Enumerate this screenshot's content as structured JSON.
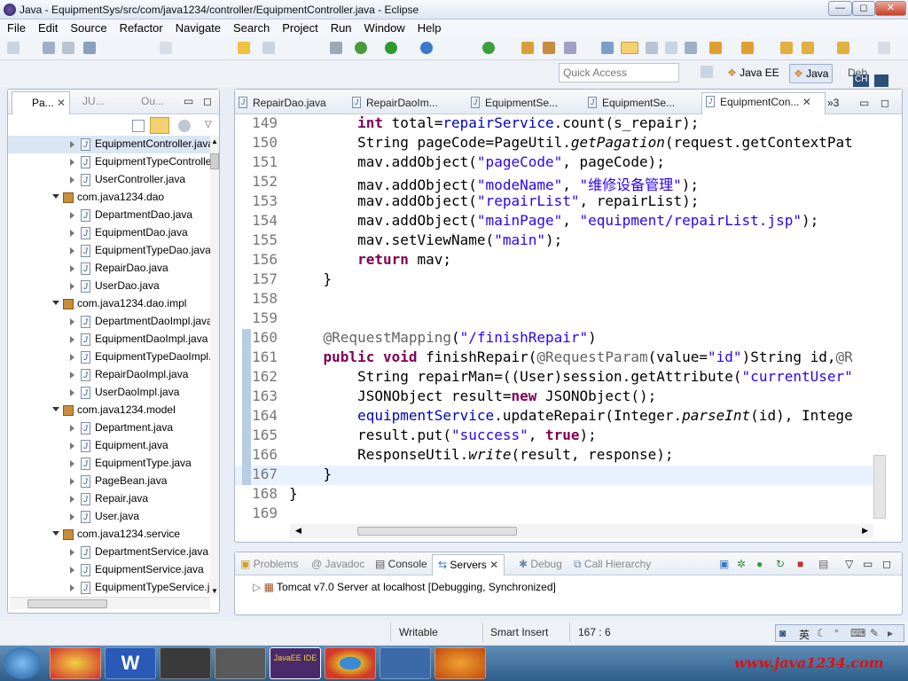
{
  "window": {
    "title": "Java - EquipmentSys/src/com/java1234/controller/EquipmentController.java - Eclipse"
  },
  "menu": [
    "File",
    "Edit",
    "Source",
    "Refactor",
    "Navigate",
    "Search",
    "Project",
    "Run",
    "Window",
    "Help"
  ],
  "quick_access": "Quick Access",
  "perspectives": {
    "javaee": "Java EE",
    "java": "Java",
    "debug": "Deb"
  },
  "left": {
    "tabs": [
      "Pa...",
      "JU...",
      "Ou..."
    ],
    "tree": [
      {
        "type": "file",
        "label": "EquipmentController.java",
        "indent": 1
      },
      {
        "type": "file",
        "label": "EquipmentTypeController.java",
        "indent": 1
      },
      {
        "type": "file",
        "label": "UserController.java",
        "indent": 1
      },
      {
        "type": "pkg",
        "label": "com.java1234.dao",
        "indent": 0
      },
      {
        "type": "file",
        "label": "DepartmentDao.java",
        "indent": 1
      },
      {
        "type": "file",
        "label": "EquipmentDao.java",
        "indent": 1
      },
      {
        "type": "file",
        "label": "EquipmentTypeDao.java",
        "indent": 1
      },
      {
        "type": "file",
        "label": "RepairDao.java",
        "indent": 1
      },
      {
        "type": "file",
        "label": "UserDao.java",
        "indent": 1
      },
      {
        "type": "pkg",
        "label": "com.java1234.dao.impl",
        "indent": 0
      },
      {
        "type": "file",
        "label": "DepartmentDaoImpl.java",
        "indent": 1
      },
      {
        "type": "file",
        "label": "EquipmentDaoImpl.java",
        "indent": 1
      },
      {
        "type": "file",
        "label": "EquipmentTypeDaoImpl.java",
        "indent": 1
      },
      {
        "type": "file",
        "label": "RepairDaoImpl.java",
        "indent": 1
      },
      {
        "type": "file",
        "label": "UserDaoImpl.java",
        "indent": 1
      },
      {
        "type": "pkg",
        "label": "com.java1234.model",
        "indent": 0
      },
      {
        "type": "file",
        "label": "Department.java",
        "indent": 1
      },
      {
        "type": "file",
        "label": "Equipment.java",
        "indent": 1
      },
      {
        "type": "file",
        "label": "EquipmentType.java",
        "indent": 1
      },
      {
        "type": "file",
        "label": "PageBean.java",
        "indent": 1
      },
      {
        "type": "file",
        "label": "Repair.java",
        "indent": 1
      },
      {
        "type": "file",
        "label": "User.java",
        "indent": 1
      },
      {
        "type": "pkg",
        "label": "com.java1234.service",
        "indent": 0
      },
      {
        "type": "file",
        "label": "DepartmentService.java",
        "indent": 1
      },
      {
        "type": "file",
        "label": "EquipmentService.java",
        "indent": 1
      },
      {
        "type": "file",
        "label": "EquipmentTypeService.java",
        "indent": 1
      }
    ]
  },
  "editor": {
    "tabs": [
      "RepairDao.java",
      "RepairDaoIm...",
      "EquipmentSe...",
      "EquipmentSe...",
      "EquipmentCon..."
    ],
    "overflow": "»3",
    "lines": [
      {
        "n": "149",
        "html": "        <span class='kw'>int</span> total=<span class='fd'>repairService</span>.count(s_repair);"
      },
      {
        "n": "150",
        "html": "        String pageCode=PageUtil.<span class='it'>getPagation</span>(request.getContextPat"
      },
      {
        "n": "151",
        "html": "        mav.addObject(<span class='st'>\"pageCode\"</span>, pageCode);"
      },
      {
        "n": "152",
        "html": "        mav.addObject(<span class='st'>\"modeName\"</span>, <span class='st'>\"维修设备管理\"</span>);"
      },
      {
        "n": "153",
        "html": "        mav.addObject(<span class='st'>\"repairList\"</span>, repairList);"
      },
      {
        "n": "154",
        "html": "        mav.addObject(<span class='st'>\"mainPage\"</span>, <span class='st'>\"equipment/repairList.jsp\"</span>);"
      },
      {
        "n": "155",
        "html": "        mav.setViewName(<span class='st'>\"main\"</span>);"
      },
      {
        "n": "156",
        "html": "        <span class='kw'>return</span> mav;"
      },
      {
        "n": "157",
        "html": "    }"
      },
      {
        "n": "158",
        "html": ""
      },
      {
        "n": "159",
        "html": ""
      },
      {
        "n": "160",
        "html": "    <span class='an'>@RequestMapping</span>(<span class='st'>\"/finishRepair\"</span>)"
      },
      {
        "n": "161",
        "html": "    <span class='kw'>public</span> <span class='kw'>void</span> finishRepair(<span class='an'>@RequestParam</span>(value=<span class='st'>\"id\"</span>)String id,<span class='an'>@R</span>"
      },
      {
        "n": "162",
        "html": "        String repairMan=((User)session.getAttribute(<span class='st'>\"currentUser\"</span>"
      },
      {
        "n": "163",
        "html": "        JSONObject result=<span class='kw'>new</span> JSONObject();"
      },
      {
        "n": "164",
        "html": "        <span class='fd'>equipmentService</span>.updateRepair(Integer.<span class='it'>parseInt</span>(id), Intege"
      },
      {
        "n": "165",
        "html": "        result.put(<span class='st'>\"success\"</span>, <span class='kw'>true</span>);"
      },
      {
        "n": "166",
        "html": "        ResponseUtil.<span class='it'>write</span>(result, response);"
      },
      {
        "n": "167",
        "html": "    }"
      },
      {
        "n": "168",
        "html": "}"
      },
      {
        "n": "169",
        "html": ""
      }
    ]
  },
  "bottom": {
    "tabs": [
      "Problems",
      "@ Javadoc",
      "Console",
      "Servers",
      "Debug",
      "Call Hierarchy"
    ],
    "server": "Tomcat v7.0 Server at localhost  [Debugging, Synchronized]"
  },
  "status": {
    "writable": "Writable",
    "insert": "Smart Insert",
    "position": "167 : 6"
  },
  "ime": {
    "lang": "英",
    "ch": "CH"
  },
  "taskbar": {
    "brand": "www.java1234.com",
    "ide_label": "JavaEE IDE"
  }
}
